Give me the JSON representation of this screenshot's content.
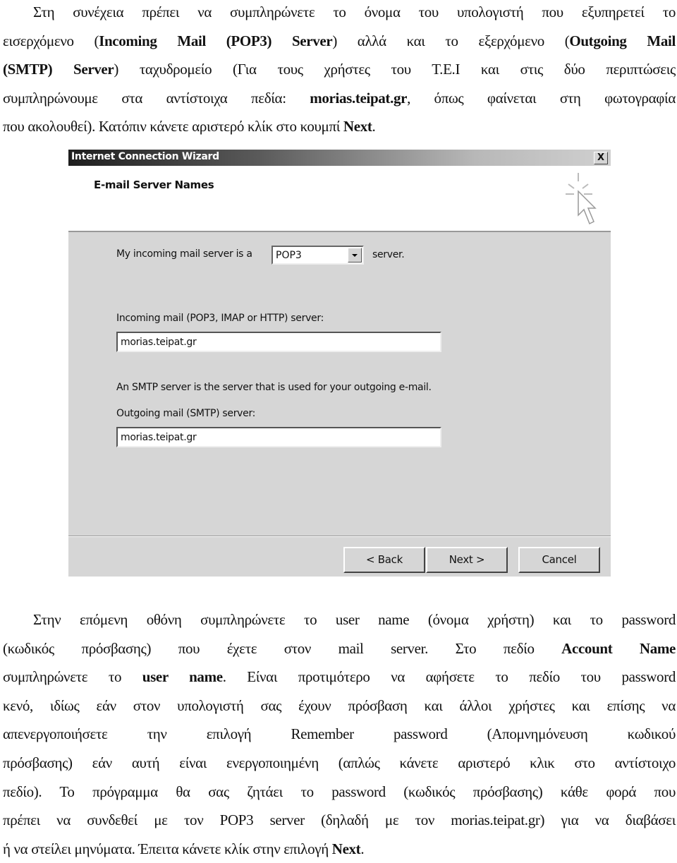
{
  "paragraph_1": [
    {
      "indent": true,
      "segments": [
        {
          "t": "Στη συνέχεια πρέπει να συμπληρώνετε το όνομα του υπολογιστή που εξυπηρετεί το"
        }
      ]
    },
    {
      "segments": [
        {
          "t": "εισερχόμενο ("
        },
        {
          "t": "Incoming Mail (POP3) Server",
          "b": true
        },
        {
          "t": ") αλλά και το εξερχόμενο ("
        },
        {
          "t": "Outgoing Mail",
          "b": true
        }
      ]
    },
    {
      "segments": [
        {
          "t": "(SMTP) Server",
          "b": true
        },
        {
          "t": ") ταχυδρομείο (Για τους χρήστες του Τ.Ε.Ι και στις δύο περιπτώσεις"
        }
      ]
    },
    {
      "segments": [
        {
          "t": "συμπληρώνουμε στα αντίστοιχα πεδία: "
        },
        {
          "t": "morias.teipat.gr",
          "b": true
        },
        {
          "t": ", όπως φαίνεται στη φωτογραφία"
        }
      ]
    },
    {
      "last": true,
      "segments": [
        {
          "t": "που ακολουθεί). Κατόπιν κάνετε αριστερό κλίκ στο κουμπί "
        },
        {
          "t": "Next",
          "b": true
        },
        {
          "t": "."
        }
      ]
    }
  ],
  "dialog": {
    "title": "Internet Connection Wizard",
    "close_label": "X",
    "header_title": "E-mail Server Names",
    "server_type_label": "My incoming mail server is a",
    "server_type_value": "POP3",
    "server_suffix": "server.",
    "incoming_label": "Incoming mail (POP3, IMAP or HTTP) server:",
    "incoming_value": "morias.teipat.gr",
    "smtp_note": "An SMTP server is the server that is used for your outgoing e-mail.",
    "outgoing_label": "Outgoing mail (SMTP) server:",
    "outgoing_value": "morias.teipat.gr",
    "back_label": "< Back",
    "next_label": "Next >",
    "cancel_label": "Cancel"
  },
  "paragraph_2": [
    {
      "indent": true,
      "segments": [
        {
          "t": "Στην επόμενη οθόνη συμπληρώνετε το user name (όνομα χρήστη) και το password"
        }
      ]
    },
    {
      "segments": [
        {
          "t": "(κωδικός πρόσβασης) που έχετε στον mail server. Στο πεδίο "
        },
        {
          "t": "Account Name",
          "b": true
        }
      ]
    },
    {
      "segments": [
        {
          "t": "συμπληρώνετε το "
        },
        {
          "t": "user name",
          "b": true
        },
        {
          "t": ". Είναι προτιμότερο να αφήσετε το πεδίο του password"
        }
      ]
    },
    {
      "segments": [
        {
          "t": "κενό, ιδίως εάν στον υπολογιστή σας έχουν πρόσβαση και άλλοι χρήστες και επίσης να"
        }
      ]
    },
    {
      "segments": [
        {
          "t": "απενεργοποιήσετε την επιλογή Remember password (Απομνημόνευση κωδικού"
        }
      ]
    },
    {
      "segments": [
        {
          "t": "πρόσβασης) εάν αυτή είναι ενεργοποιημένη (απλώς κάνετε αριστερό κλικ στο αντίστοιχο"
        }
      ]
    },
    {
      "segments": [
        {
          "t": "πεδίο). Το πρόγραμμα θα σας ζητάει το password (κωδικός πρόσβασης) κάθε φορά που"
        }
      ]
    },
    {
      "segments": [
        {
          "t": "πρέπει να συνδεθεί με τον POP3 server (δηλαδή με τον morias.teipat.gr) για να διαβάσει"
        }
      ]
    },
    {
      "last": true,
      "segments": [
        {
          "t": "ή να στείλει μηνύματα. Έπειτα κάνετε κλίκ στην επιλογή "
        },
        {
          "t": "Next",
          "b": true
        },
        {
          "t": "."
        }
      ]
    }
  ]
}
